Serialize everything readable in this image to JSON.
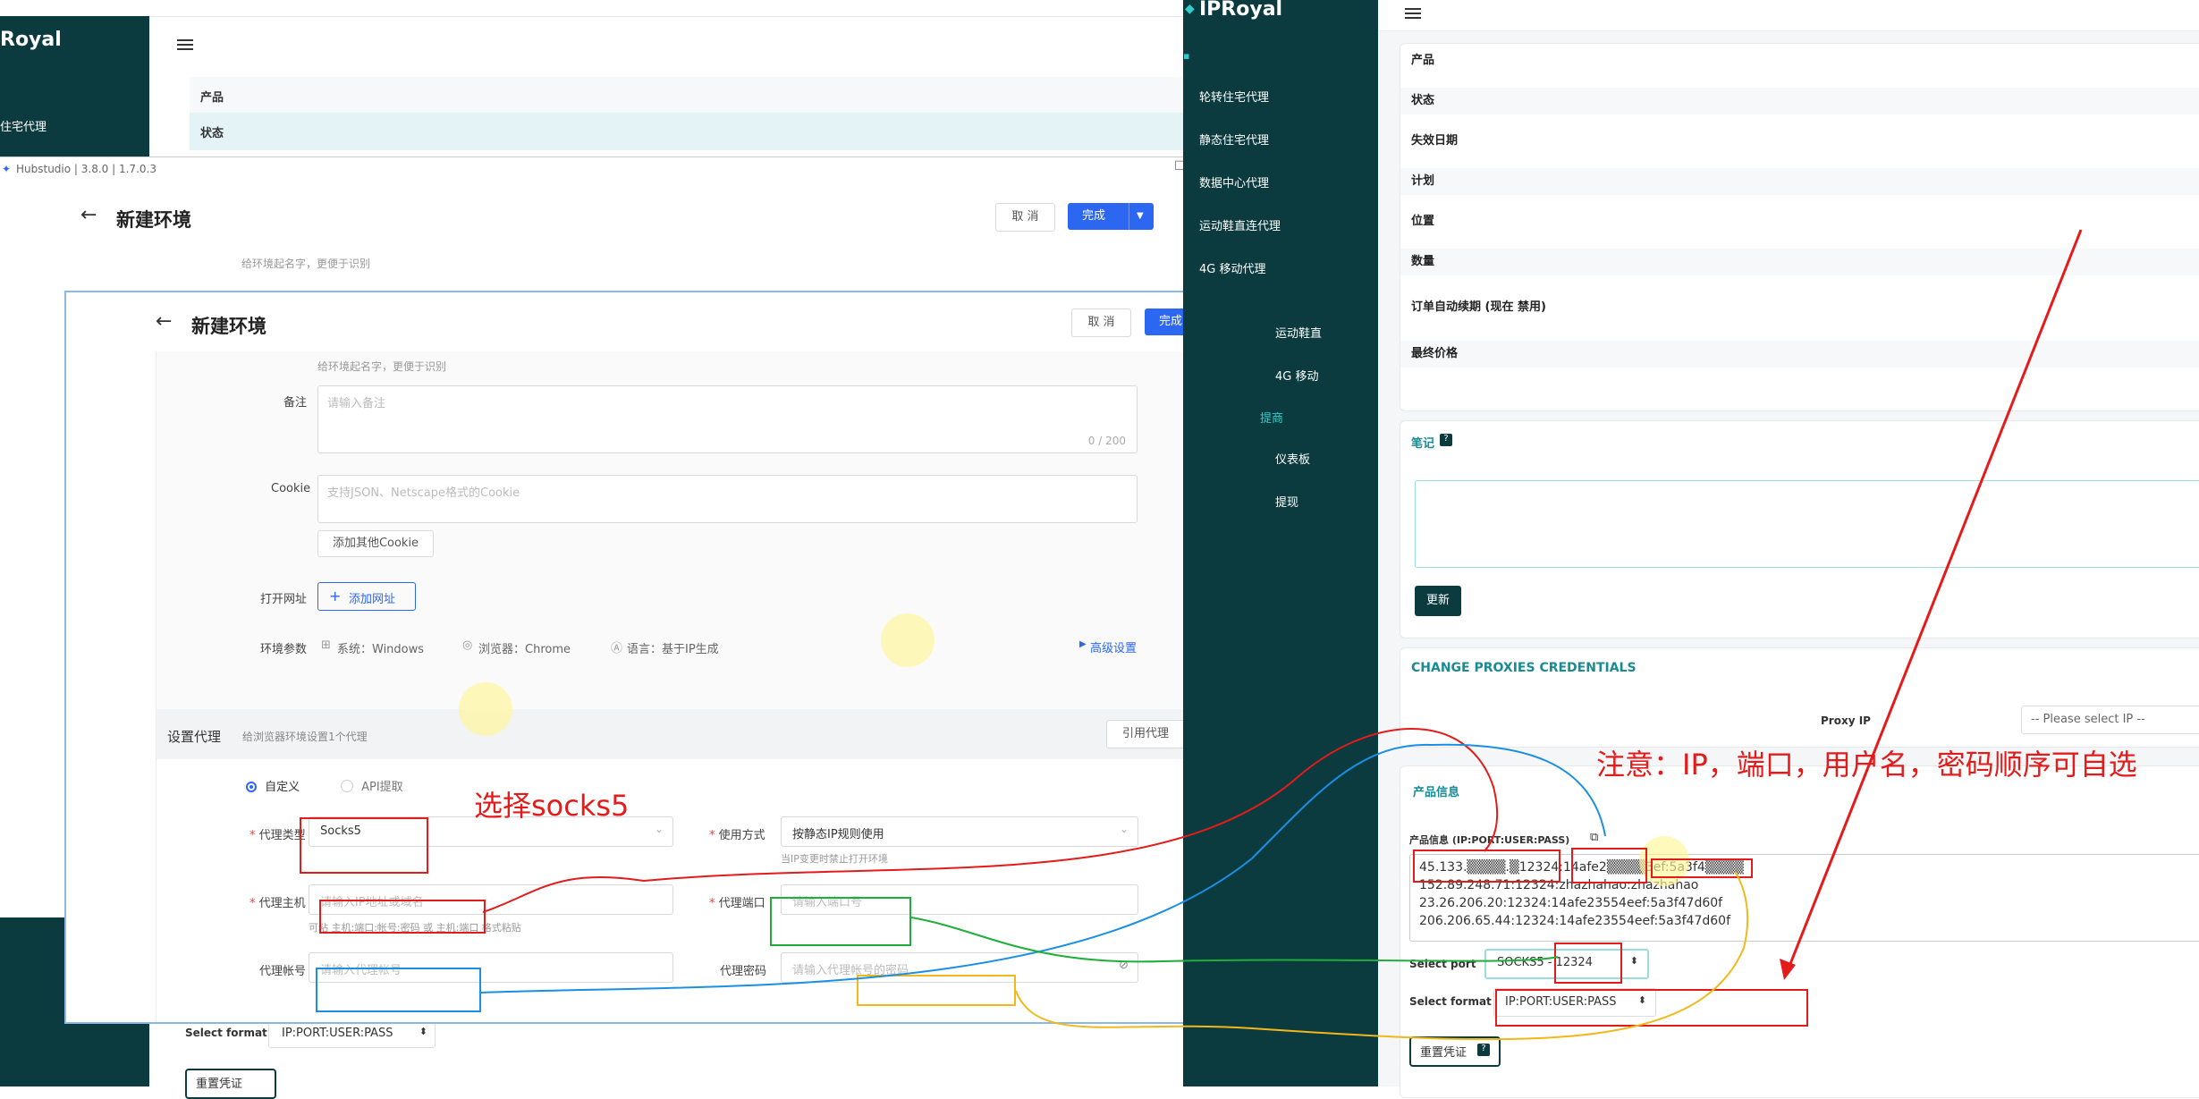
{
  "bg_ipr": {
    "brand": "Royal",
    "nav_item": "住宅代理",
    "rows": [
      "产品",
      "状态"
    ],
    "select_format_label": "Select format",
    "select_format_value": "IP:PORT:USER:PASS",
    "reset_label": "重置凭证"
  },
  "hubstudio_back": {
    "title_bar": "Hubstudio | 3.8.0 | 1.7.0.3",
    "page_title": "新建环境",
    "cancel": "取 消",
    "done": "完成",
    "hint": "给环境起名字，更便于识别"
  },
  "form": {
    "page_title": "新建环境",
    "cancel": "取 消",
    "done": "完成",
    "name_hint": "给环境起名字，更便于识别",
    "remark_label": "备注",
    "remark_placeholder": "请输入备注",
    "remark_count": "0 / 200",
    "cookie_label": "Cookie",
    "cookie_placeholder": "支持JSON、Netscape格式的Cookie",
    "add_cookie": "添加其他Cookie",
    "open_url_label": "打开网址",
    "add_url": "添加网址",
    "env_params_label": "环境参数",
    "system": "系统：Windows",
    "browser": "浏览器：Chrome",
    "language": "语言：基于IP生成",
    "advanced": "高级设置",
    "proxy_section": "设置代理",
    "proxy_section_hint": "给浏览器环境设置1个代理",
    "use_proxy": "引用代理",
    "radio_custom": "自定义",
    "radio_api": "API提取",
    "proxy_type_label": "代理类型",
    "proxy_type_value": "Socks5",
    "use_mode_label": "使用方式",
    "use_mode_value": "按静态IP规则使用",
    "use_mode_hint": "当IP变更时禁止打开环境",
    "host_label": "代理主机",
    "host_placeholder": "请输入IP地址或域名",
    "host_hint": "可粘 主机:端口:帐号:密码 或 主机:端口 格式粘贴",
    "port_label": "代理端口",
    "port_placeholder": "请输入端口号",
    "account_label": "代理帐号",
    "account_placeholder": "请输入代理帐号",
    "password_label": "代理密码",
    "password_placeholder": "请输入代理帐号的密码",
    "select_format_label": "Select format",
    "select_format_value": "IP:PORT:USER:PASS",
    "reset_label": "重置凭证"
  },
  "ipr_nav": {
    "brand": "IPRoyal",
    "items": [
      "轮转住宅代理",
      "静态住宅代理",
      "数据中心代理",
      "运动鞋直连代理",
      "4G 移动代理"
    ],
    "items_back": [
      "运动鞋直",
      "4G 移动"
    ],
    "group_label": "提商",
    "dashboard": "仪表板",
    "withdraw": "提现"
  },
  "ipr_main": {
    "rows": [
      "产品",
      "状态",
      "失效日期",
      "计划",
      "位置",
      "数量",
      "订单自动续期 (现在 禁用)",
      "最终价格"
    ],
    "notes_label": "笔记",
    "notes_help": "?",
    "update_button": "更新",
    "change_creds_title": "CHANGE PROXIES CREDENTIALS",
    "proxy_ip_label": "Proxy IP",
    "proxy_ip_placeholder": "-- Please select IP --",
    "product_info_title": "产品信息",
    "product_info_label": "产品信息 (IP:PORT:USER:PASS)",
    "proxy_lines": [
      "45.133.▒▒▒▒.▒12324:14afe2▒▒▒▒3ef:5a3f4▒▒▒▒",
      "152.89.248.71:12324:zhazhahao:zhazhahao",
      "23.26.206.20:12324:14afe23554eef:5a3f47d60f",
      "206.206.65.44:12324:14afe23554eef:5a3f47d60f"
    ],
    "select_port_label": "Select port",
    "select_port_value": "SOCKS5 - 12324",
    "select_format_label": "Select format",
    "select_format_value": "IP:PORT:USER:PASS",
    "reset_label": "重置凭证",
    "reset_help": "?"
  },
  "annotations": {
    "choose_socks5": "选择socks5",
    "note": "注意：IP，端口，用户名，密码顺序可自选"
  },
  "colors": {
    "ipr_dark": "#0b3b3e",
    "hub_blue": "#2c67f2",
    "annotation_red": "#e41b1b",
    "link_teal": "#1a8a94"
  }
}
